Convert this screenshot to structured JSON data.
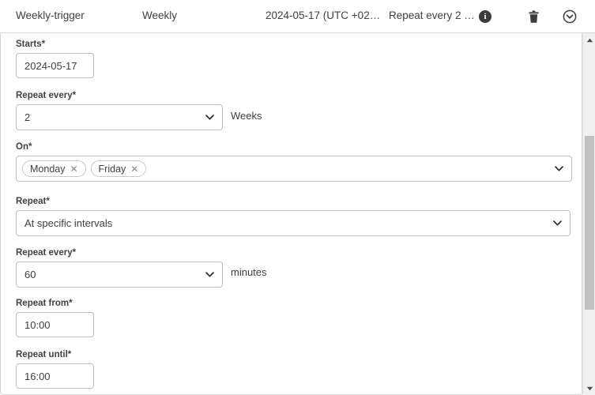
{
  "header": {
    "trigger_name": "Weekly-trigger",
    "trigger_type": "Weekly",
    "start_date": "2024-05-17 (UTC +02…",
    "summary": "Repeat every 2 …",
    "info_glyph": "i",
    "info_icon_name": "info-icon",
    "delete_icon_name": "trash-icon",
    "collapse_icon_name": "chevron-down-circle-icon"
  },
  "form": {
    "starts": {
      "label": "Starts*",
      "value": "2024-05-17"
    },
    "repeat_every_weeks": {
      "label": "Repeat every*",
      "value": "2",
      "suffix": "Weeks"
    },
    "on_days": {
      "label": "On*",
      "chips": [
        {
          "label": "Monday",
          "remove": "✕"
        },
        {
          "label": "Friday",
          "remove": "✕"
        }
      ]
    },
    "repeat_mode": {
      "label": "Repeat*",
      "value": "At specific intervals"
    },
    "repeat_every_minutes": {
      "label": "Repeat every*",
      "value": "60",
      "suffix": "minutes"
    },
    "repeat_from": {
      "label": "Repeat from*",
      "value": "10:00"
    },
    "repeat_until": {
      "label": "Repeat until*",
      "value": "16:00"
    }
  },
  "colors": {
    "text": "#404040",
    "border": "#bfbfbf",
    "panel_border": "#d6d6d6",
    "scrollbar_track": "#f0f0f0",
    "scrollbar_thumb": "#c1c1c1",
    "icon": "#3c3c3c"
  }
}
